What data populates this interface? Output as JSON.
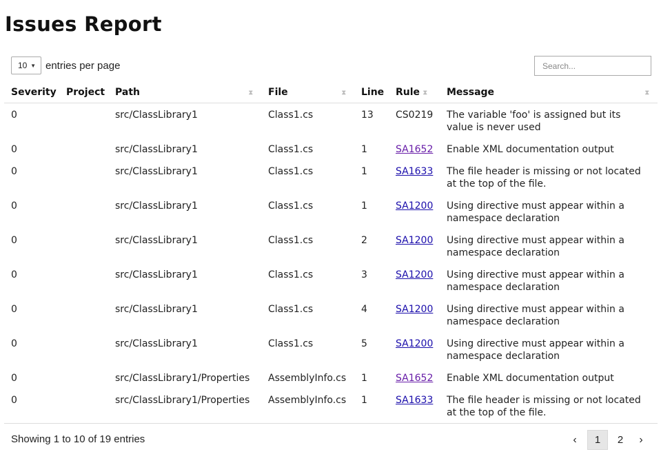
{
  "page": {
    "title": "Issues Report"
  },
  "length": {
    "value": "10",
    "label": "entries per page"
  },
  "search": {
    "placeholder": "Search..."
  },
  "table": {
    "columns": [
      "Severity",
      "Project",
      "Path",
      "File",
      "Line",
      "Rule",
      "Message"
    ],
    "rows": [
      {
        "severity": "0",
        "project": "",
        "path": "src/ClassLibrary1",
        "file": "Class1.cs",
        "line": "13",
        "rule": "CS0219",
        "message": "The variable 'foo' is assigned but its value is never used"
      },
      {
        "severity": "0",
        "project": "",
        "path": "src/ClassLibrary1",
        "file": "Class1.cs",
        "line": "1",
        "rule": "SA1652",
        "message": "Enable XML documentation output"
      },
      {
        "severity": "0",
        "project": "",
        "path": "src/ClassLibrary1",
        "file": "Class1.cs",
        "line": "1",
        "rule": "SA1633",
        "message": "The file header is missing or not located at the top of the file."
      },
      {
        "severity": "0",
        "project": "",
        "path": "src/ClassLibrary1",
        "file": "Class1.cs",
        "line": "1",
        "rule": "SA1200",
        "message": "Using directive must appear within a namespace declaration"
      },
      {
        "severity": "0",
        "project": "",
        "path": "src/ClassLibrary1",
        "file": "Class1.cs",
        "line": "2",
        "rule": "SA1200",
        "message": "Using directive must appear within a namespace declaration"
      },
      {
        "severity": "0",
        "project": "",
        "path": "src/ClassLibrary1",
        "file": "Class1.cs",
        "line": "3",
        "rule": "SA1200",
        "message": "Using directive must appear within a namespace declaration"
      },
      {
        "severity": "0",
        "project": "",
        "path": "src/ClassLibrary1",
        "file": "Class1.cs",
        "line": "4",
        "rule": "SA1200",
        "message": "Using directive must appear within a namespace declaration"
      },
      {
        "severity": "0",
        "project": "",
        "path": "src/ClassLibrary1",
        "file": "Class1.cs",
        "line": "5",
        "rule": "SA1200",
        "message": "Using directive must appear within a namespace declaration"
      },
      {
        "severity": "0",
        "project": "",
        "path": "src/ClassLibrary1/Properties",
        "file": "AssemblyInfo.cs",
        "line": "1",
        "rule": "SA1652",
        "message": "Enable XML documentation output"
      },
      {
        "severity": "0",
        "project": "",
        "path": "src/ClassLibrary1/Properties",
        "file": "AssemblyInfo.cs",
        "line": "1",
        "rule": "SA1633",
        "message": "The file header is missing or not located at the top of the file."
      }
    ]
  },
  "footer": {
    "info": "Showing 1 to 10 of 19 entries",
    "prev": "‹",
    "pages": [
      "1",
      "2"
    ],
    "next": "›"
  },
  "colors": {
    "link": "#1a0dab",
    "visited_link": "#681da8",
    "current_page_bg": "#e6e6e6"
  }
}
